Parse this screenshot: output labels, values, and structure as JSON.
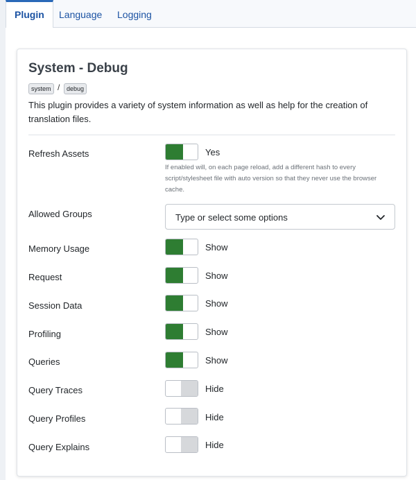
{
  "tabs": [
    {
      "label": "Plugin",
      "active": true
    },
    {
      "label": "Language",
      "active": false
    },
    {
      "label": "Logging",
      "active": false
    }
  ],
  "plugin": {
    "title": "System - Debug",
    "badges": [
      "system",
      "debug"
    ],
    "separator": "/",
    "description": "This plugin provides a variety of system information as well as help for the creation of translation files."
  },
  "fields": {
    "refresh_assets": {
      "label": "Refresh Assets",
      "state": "Yes",
      "help": "If enabled will, on each page reload, add a different hash to every script/stylesheet file with auto version so that they never use the browser cache."
    },
    "allowed_groups": {
      "label": "Allowed Groups",
      "placeholder": "Type or select some options"
    },
    "memory_usage": {
      "label": "Memory Usage",
      "state": "Show"
    },
    "request": {
      "label": "Request",
      "state": "Show"
    },
    "session_data": {
      "label": "Session Data",
      "state": "Show"
    },
    "profiling": {
      "label": "Profiling",
      "state": "Show"
    },
    "queries": {
      "label": "Queries",
      "state": "Show"
    },
    "query_traces": {
      "label": "Query Traces",
      "state": "Hide"
    },
    "query_profiles": {
      "label": "Query Profiles",
      "state": "Hide"
    },
    "query_explains": {
      "label": "Query Explains",
      "state": "Hide"
    }
  },
  "colors": {
    "toggle_on": "#2e7d32",
    "toggle_off": "#d6d8db",
    "tab_active_accent": "#2a69b8",
    "link": "#1c53a3"
  },
  "icons": {
    "select_chevron": "chevron-down-icon"
  }
}
